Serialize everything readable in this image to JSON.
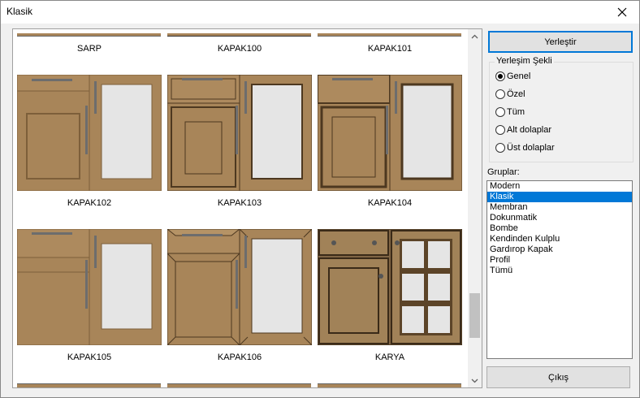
{
  "window": {
    "title": "Klasik"
  },
  "gallery": {
    "rows": [
      [
        {
          "label": "SARP"
        },
        {
          "label": "KAPAK100"
        },
        {
          "label": "KAPAK101"
        }
      ],
      [
        {
          "label": "KAPAK102"
        },
        {
          "label": "KAPAK103"
        },
        {
          "label": "KAPAK104"
        }
      ],
      [
        {
          "label": "KAPAK105"
        },
        {
          "label": "KAPAK106"
        },
        {
          "label": "KARYA"
        }
      ]
    ]
  },
  "buttons": {
    "place": "Yerleştir",
    "exit": "Çıkış"
  },
  "placement": {
    "title": "Yerleşim Şekli",
    "options": [
      {
        "label": "Genel",
        "checked": true
      },
      {
        "label": "Özel",
        "checked": false
      },
      {
        "label": "Tüm",
        "checked": false
      },
      {
        "label": "Alt dolaplar",
        "checked": false
      },
      {
        "label": "Üst dolaplar",
        "checked": false
      }
    ]
  },
  "groups": {
    "label": "Gruplar:",
    "items": [
      "Modern",
      "Klasik",
      "Membran",
      "Dokunmatik",
      "Bombe",
      "Kendinden Kulplu",
      "Gardırop Kapak",
      "Profil",
      "Tümü"
    ],
    "selected": "Klasik"
  },
  "colors": {
    "wood": "#a88559",
    "wood_dark": "#7d5f3a",
    "glass": "#e5e5e5",
    "accent": "#0078d7"
  }
}
